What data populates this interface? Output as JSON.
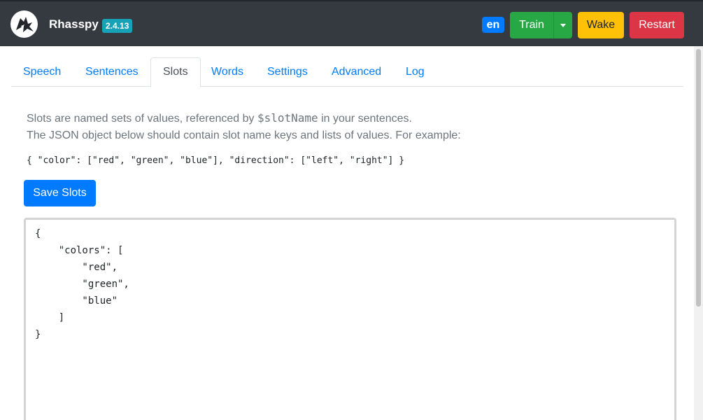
{
  "navbar": {
    "brand": "Rhasspy",
    "version": "2.4.13",
    "language": "en",
    "buttons": {
      "train": "Train",
      "wake": "Wake",
      "restart": "Restart"
    }
  },
  "tabs": [
    "Speech",
    "Sentences",
    "Slots",
    "Words",
    "Settings",
    "Advanced",
    "Log"
  ],
  "active_tab": "Slots",
  "intro": {
    "line1_before": "Slots are named sets of values, referenced by ",
    "line1_code": "$slotName",
    "line1_after": " in your sentences.",
    "line2": "The JSON object below should contain slot name keys and lists of values. For example:"
  },
  "example": "{ \"color\": [\"red\", \"green\", \"blue\"], \"direction\": [\"left\", \"right\"] }",
  "save_button": "Save Slots",
  "editor_value": "{\n    \"colors\": [\n        \"red\",\n        \"green\",\n        \"blue\"\n    ]\n}",
  "colors": {
    "navbar": "#343a40",
    "primary": "#007bff",
    "success": "#28a745",
    "warning": "#ffc107",
    "danger": "#dc3545",
    "info": "#17a2b8"
  },
  "icons": {
    "logo": "rhasspy-logo-icon",
    "train_menu": "caret-down-icon"
  }
}
